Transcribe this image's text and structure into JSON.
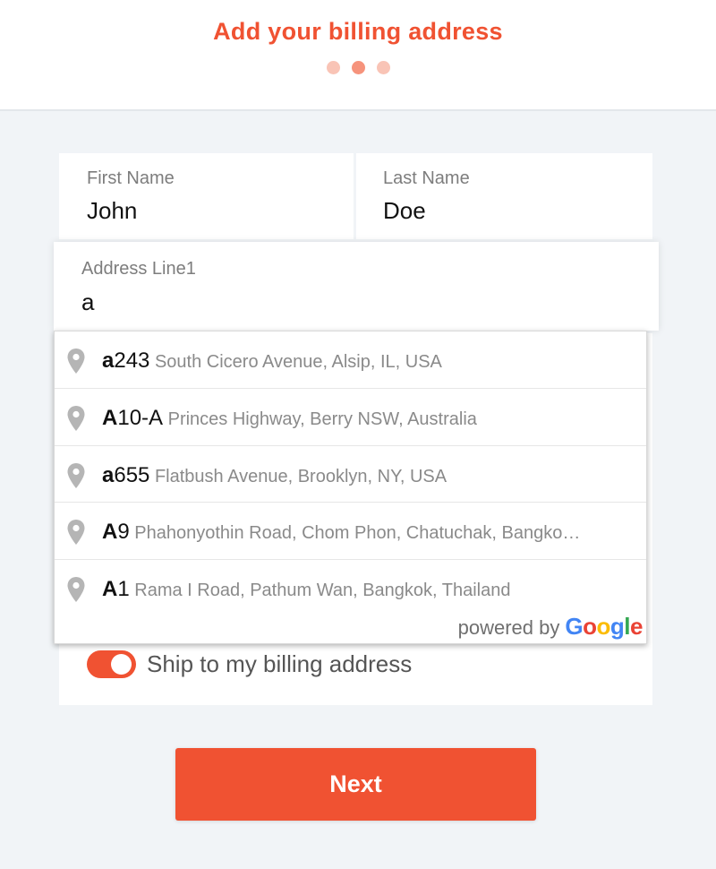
{
  "header": {
    "title": "Add your billing address",
    "step_dots": [
      {
        "active": false
      },
      {
        "active": true
      },
      {
        "active": false
      }
    ]
  },
  "form": {
    "first_name": {
      "label": "First Name",
      "value": "John"
    },
    "last_name": {
      "label": "Last Name",
      "value": "Doe"
    },
    "address_line1": {
      "label": "Address Line1",
      "value": "a"
    }
  },
  "autocomplete": {
    "icon": "map-pin-icon",
    "suggestions": [
      {
        "match": "a",
        "main_rest": "243",
        "secondary": "South Cicero Avenue, Alsip, IL, USA"
      },
      {
        "match": "A",
        "main_rest": "10-A",
        "secondary": "Princes Highway, Berry NSW, Australia"
      },
      {
        "match": "a",
        "main_rest": "655",
        "secondary": "Flatbush Avenue, Brooklyn, NY, USA"
      },
      {
        "match": "A",
        "main_rest": "9",
        "secondary": "Phahonyothin Road, Chom Phon, Chatuchak, Bangko…"
      },
      {
        "match": "A",
        "main_rest": "1",
        "secondary": "Rama I Road, Pathum Wan, Bangkok, Thailand"
      }
    ],
    "powered_by": "powered by",
    "google_letters": [
      "G",
      "o",
      "o",
      "g",
      "l",
      "e"
    ]
  },
  "shipping": {
    "toggle_on": true,
    "label": "Ship to my billing address"
  },
  "next_button": "Next",
  "colors": {
    "accent": "#f05232",
    "background": "#f1f4f7"
  }
}
